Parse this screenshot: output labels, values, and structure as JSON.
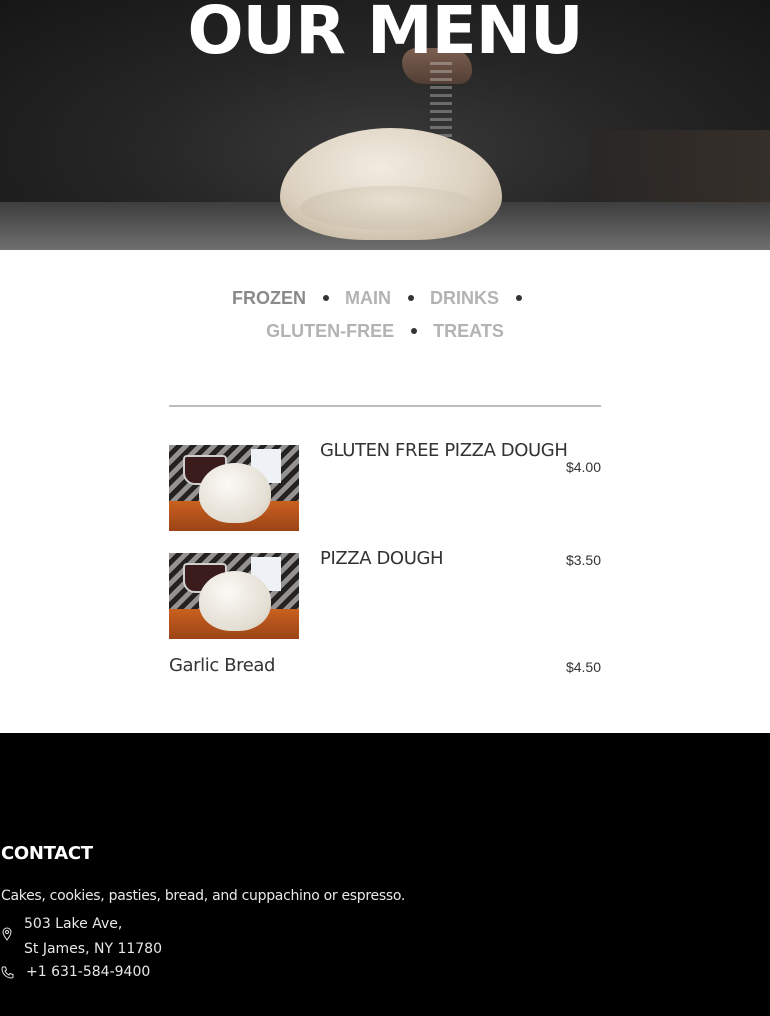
{
  "hero": {
    "title": "OUR MENU"
  },
  "categories": [
    {
      "label": "FROZEN",
      "active": true
    },
    {
      "label": "MAIN",
      "active": false
    },
    {
      "label": "DRINKS",
      "active": false
    },
    {
      "label": "GLUTEN-FREE",
      "active": false
    },
    {
      "label": "TREATS",
      "active": false
    }
  ],
  "items": [
    {
      "name": "GLUTEN FREE PIZZA DOUGH",
      "price": "$4.00"
    },
    {
      "name": "PIZZA DOUGH",
      "price": "$3.50"
    },
    {
      "name": "Garlic Bread",
      "price": "$4.50"
    }
  ],
  "footer": {
    "heading": "CONTACT",
    "description": "Cakes, cookies, pasties, bread, and cuppachino or espresso.",
    "address_line1": "503 Lake Ave,",
    "address_line2": "St James, NY 11780",
    "phone": "+1 631-584-9400",
    "icons": [
      "location-pin-icon",
      "phone-icon"
    ]
  }
}
